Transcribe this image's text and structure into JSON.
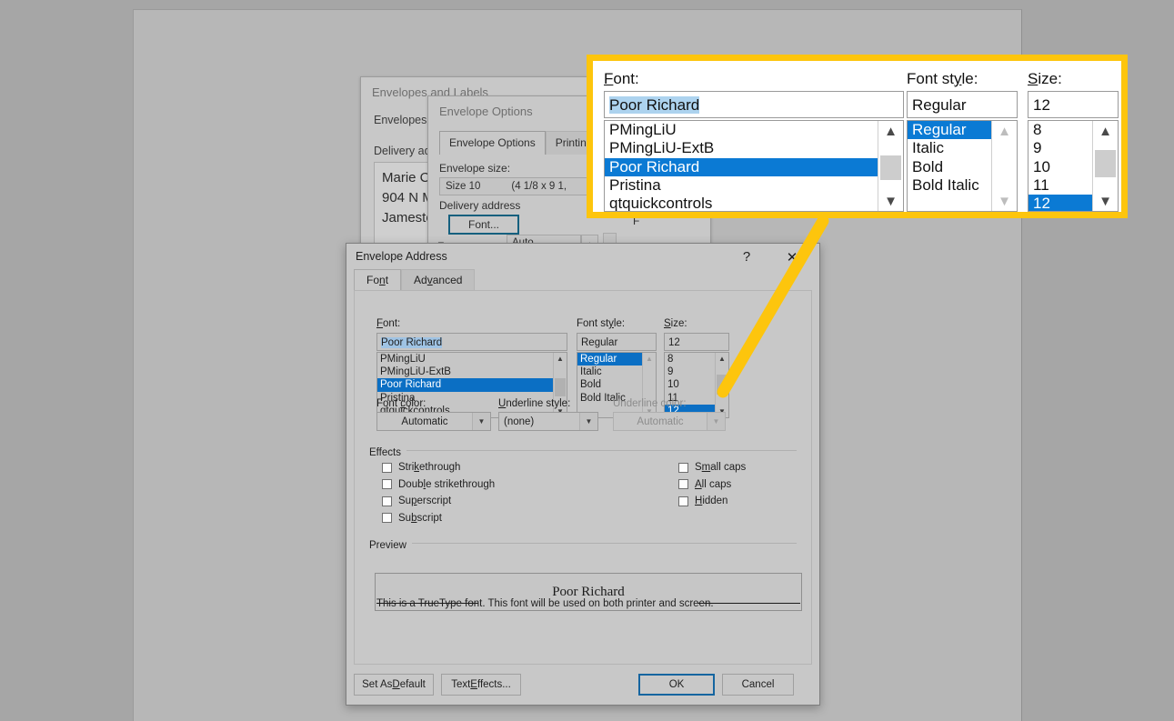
{
  "colors": {
    "page_background": "#a6a6a6",
    "document_background": "#b7b7b7",
    "dialog_face": "#c8c8c8",
    "selection_blue": "#0b6fc4",
    "callout_yellow": "#fdc50d",
    "focus_blue": "#1565a0",
    "textbox_selection": "#9fc3e4"
  },
  "background_dialogs": {
    "envelopes_and_labels": {
      "title": "Envelopes and Labels",
      "tab_label": "Envelopes",
      "delivery_label": "Delivery ad",
      "address_lines": [
        "Marie C",
        "904 N M",
        "Jamesto"
      ]
    },
    "envelope_options": {
      "title": "Envelope Options",
      "tabs": [
        {
          "label": "Envelope Options",
          "active": true
        },
        {
          "label": "Printing O",
          "active": false
        }
      ],
      "envelope_size_label": "Envelope size:",
      "envelope_size_value": "Size 10",
      "envelope_size_dims": "(4 1/8 x 9 1,",
      "delivery_address_group": "Delivery address",
      "font_button": "Font...",
      "font_button_right": "F",
      "from_top_label": "From top:",
      "from_top_value": "Auto"
    }
  },
  "dialog": {
    "title": "Envelope Address",
    "help_icon": "question-mark-icon",
    "close_icon": "close-x-icon",
    "tabs": [
      {
        "id": "font",
        "label": "Font",
        "mnemonic": "n",
        "active": true
      },
      {
        "id": "advanced",
        "label": "Advanced",
        "mnemonic": "v",
        "active": false
      }
    ],
    "font_section": {
      "font": {
        "label": "Font:",
        "label_mnemonic": "F",
        "value": "Poor Richard",
        "items": [
          {
            "label": "PMingLiU",
            "selected": false
          },
          {
            "label": "PMingLiU-ExtB",
            "selected": false
          },
          {
            "label": "Poor Richard",
            "selected": true
          },
          {
            "label": "Pristina",
            "selected": false
          },
          {
            "label": "qtquickcontrols",
            "selected": false
          }
        ],
        "scrollbar": {
          "up_icon": "chevron-up-icon",
          "down_icon": "chevron-down-icon",
          "enabled": true
        }
      },
      "style": {
        "label": "Font style:",
        "label_mnemonic": "y",
        "value": "Regular",
        "items": [
          {
            "label": "Regular",
            "selected": true
          },
          {
            "label": "Italic",
            "selected": false
          },
          {
            "label": "Bold",
            "selected": false
          },
          {
            "label": "Bold Italic",
            "selected": false
          }
        ],
        "scrollbar": {
          "up_icon": "chevron-up-icon",
          "down_icon": "chevron-down-icon",
          "enabled": false
        }
      },
      "size": {
        "label": "Size:",
        "label_mnemonic": "S",
        "value": "12",
        "items": [
          {
            "label": "8",
            "selected": false
          },
          {
            "label": "9",
            "selected": false
          },
          {
            "label": "10",
            "selected": false
          },
          {
            "label": "11",
            "selected": false
          },
          {
            "label": "12",
            "selected": true
          }
        ],
        "scrollbar": {
          "up_icon": "chevron-up-icon",
          "down_icon": "chevron-down-icon",
          "enabled": true
        }
      }
    },
    "dropdowns": {
      "font_color": {
        "label": "Font color:",
        "label_mnemonic": "c",
        "value": "Automatic",
        "disabled": false,
        "arrow_icon": "chevron-down-icon"
      },
      "underline_style": {
        "label": "Underline style:",
        "label_mnemonic": "U",
        "value": "(none)",
        "disabled": false,
        "arrow_icon": "chevron-down-icon"
      },
      "underline_color": {
        "label": "Underline color:",
        "label_mnemonic": "",
        "value": "Automatic",
        "disabled": true,
        "arrow_icon": "chevron-down-icon"
      }
    },
    "effects": {
      "caption": "Effects",
      "left_column": [
        {
          "label": "Strikethrough",
          "checked": false
        },
        {
          "label": "Double strikethrough",
          "checked": false
        },
        {
          "label": "Superscript",
          "checked": false
        },
        {
          "label": "Subscript",
          "checked": false
        }
      ],
      "right_column": [
        {
          "label": "Small caps",
          "checked": false
        },
        {
          "label": "All caps",
          "checked": false
        },
        {
          "label": "Hidden",
          "checked": false
        }
      ]
    },
    "preview": {
      "caption": "Preview",
      "sample_text": "Poor Richard",
      "note": "This is a TrueType font. This font will be used on both printer and screen."
    },
    "buttons": {
      "set_as_default": "Set As Default",
      "text_effects": "Text Effects...",
      "ok": "OK",
      "cancel": "Cancel",
      "focused": "ok"
    }
  },
  "callout": {
    "font": {
      "label": "Font:",
      "value": "Poor Richard",
      "items": [
        {
          "label": "PMingLiU",
          "selected": false
        },
        {
          "label": "PMingLiU-ExtB",
          "selected": false
        },
        {
          "label": "Poor Richard",
          "selected": true
        },
        {
          "label": "Pristina",
          "selected": false
        },
        {
          "label": "qtquickcontrols",
          "selected": false
        }
      ]
    },
    "style": {
      "label": "Font style:",
      "value": "Regular",
      "items": [
        {
          "label": "Regular",
          "selected": true
        },
        {
          "label": "Italic",
          "selected": false
        },
        {
          "label": "Bold",
          "selected": false
        },
        {
          "label": "Bold Italic",
          "selected": false
        }
      ]
    },
    "size": {
      "label": "Size:",
      "value": "12",
      "items": [
        {
          "label": "8",
          "selected": false
        },
        {
          "label": "9",
          "selected": false
        },
        {
          "label": "10",
          "selected": false
        },
        {
          "label": "11",
          "selected": false
        },
        {
          "label": "12",
          "selected": true
        }
      ]
    }
  }
}
